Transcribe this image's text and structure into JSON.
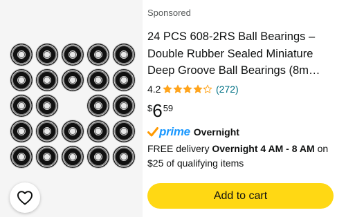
{
  "product": {
    "sponsored_label": "Sponsored",
    "title": "24 PCS 608-2RS Ball Bearings – Double Rubber Sealed Miniature Deep Groove Ball Bearings (8m…",
    "rating": {
      "value": "4.2",
      "stars_filled": 4.2,
      "stars_total": 5,
      "review_count": "(272)"
    },
    "price": {
      "currency_symbol": "$",
      "whole": "6",
      "fraction": "59"
    },
    "prime": {
      "logo_text": "prime",
      "speed_label": "Overnight"
    },
    "delivery": {
      "prefix": "FREE delivery",
      "highlight": "Overnight 4 AM - 8 AM",
      "suffix": "on $25 of qualifying items"
    },
    "add_to_cart_label": "Add to cart",
    "image": {
      "icon": "ball-bearings-image",
      "bearing_count_shown": 23
    },
    "wishlist_icon": "heart-icon",
    "colors": {
      "star": "#ffa41c",
      "review_link": "#007185",
      "prime_blue": "#1a98ff",
      "prime_check": "#ff9900",
      "cart_button": "#ffd814",
      "secondary_text": "#565959"
    }
  }
}
